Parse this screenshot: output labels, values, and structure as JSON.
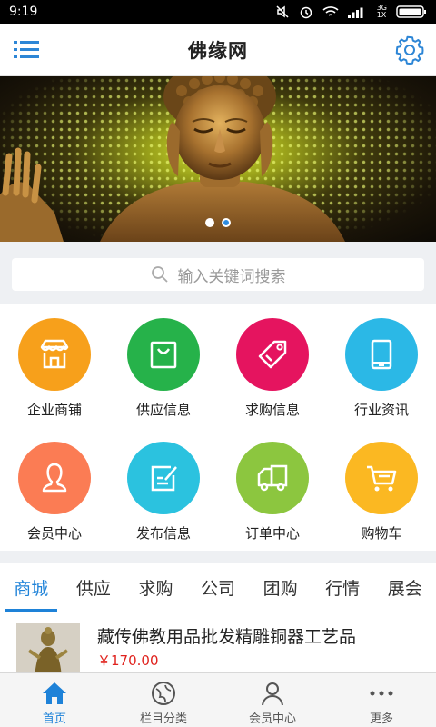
{
  "status_bar": {
    "time": "9:19",
    "network": "3G",
    "sim": "1X"
  },
  "header": {
    "title": "佛缘网",
    "menu_icon": "menu-icon",
    "settings_icon": "gear-icon"
  },
  "banner": {
    "slides": 2,
    "active_slide": 1
  },
  "search": {
    "placeholder": "输入关键词搜索"
  },
  "grid": {
    "items": [
      {
        "label": "企业商铺",
        "icon": "store-icon",
        "color": "#f7a01b"
      },
      {
        "label": "供应信息",
        "icon": "bag-icon",
        "color": "#26b24a"
      },
      {
        "label": "求购信息",
        "icon": "tag-icon",
        "color": "#e5145f"
      },
      {
        "label": "行业资讯",
        "icon": "tablet-icon",
        "color": "#2bb8e6"
      },
      {
        "label": "会员中心",
        "icon": "user-icon",
        "color": "#fb7c54"
      },
      {
        "label": "发布信息",
        "icon": "edit-icon",
        "color": "#2bc2df"
      },
      {
        "label": "订单中心",
        "icon": "truck-icon",
        "color": "#8cc63f"
      },
      {
        "label": "购物车",
        "icon": "cart-icon",
        "color": "#fbb822"
      }
    ]
  },
  "tabs": [
    "商城",
    "供应",
    "求购",
    "公司",
    "团购",
    "行情",
    "展会"
  ],
  "active_tab": 0,
  "product": {
    "title": "藏传佛教用品批发精雕铜器工艺品",
    "price": "￥170.00"
  },
  "bottom_nav": [
    {
      "label": "首页",
      "icon": "home-icon",
      "active": true
    },
    {
      "label": "栏目分类",
      "icon": "compass-icon",
      "active": false
    },
    {
      "label": "会员中心",
      "icon": "user-icon",
      "active": false
    },
    {
      "label": "更多",
      "icon": "more-icon",
      "active": false
    }
  ],
  "colors": {
    "accent": "#1e82d8",
    "price": "#e0231e"
  }
}
